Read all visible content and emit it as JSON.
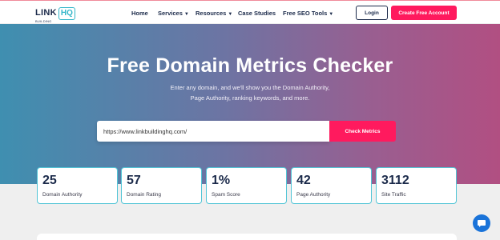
{
  "header": {
    "logo_link": "LINK",
    "logo_building": "BUILDING",
    "logo_hq": "HQ",
    "nav": [
      {
        "label": "Home"
      },
      {
        "label": "Services",
        "icon": "chevron-down-icon"
      },
      {
        "label": "Resources",
        "icon": "chevron-down-icon"
      },
      {
        "label": "Case Studies"
      },
      {
        "label": "Free SEO Tools",
        "icon": "chevron-down-icon"
      }
    ],
    "login_label": "Login",
    "create_label": "Create Free Account"
  },
  "hero": {
    "title": "Free Domain Metrics Checker",
    "subtitle_line1": "Enter any domain, and we'll show you the Domain Authority,",
    "subtitle_line2": "Page Authority, ranking keywords, and more.",
    "search_value": "https://www.linkbuildinghq.com/",
    "check_label": "Check Metrics"
  },
  "metrics": [
    {
      "value": "25",
      "label": "Domain Authority"
    },
    {
      "value": "57",
      "label": "Domain Rating"
    },
    {
      "value": "1%",
      "label": "Spam Score"
    },
    {
      "value": "42",
      "label": "Page Authority"
    },
    {
      "value": "3112",
      "label": "Site Traffic"
    }
  ],
  "colors": {
    "accent": "#ff1a5e",
    "teal": "#34b6c9",
    "navy": "#1b2a4a",
    "chat": "#1a73d9"
  },
  "chat": {
    "icon": "chat-icon"
  }
}
